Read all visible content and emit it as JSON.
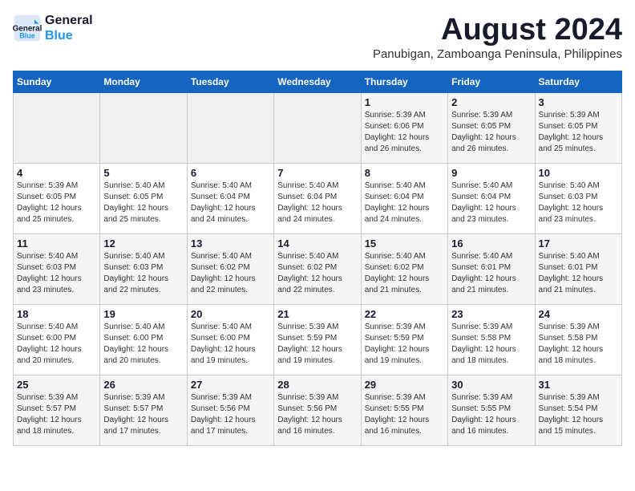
{
  "header": {
    "logo_line1": "General",
    "logo_line2": "Blue",
    "month_year": "August 2024",
    "subtitle": "Panubigan, Zamboanga Peninsula, Philippines"
  },
  "weekdays": [
    "Sunday",
    "Monday",
    "Tuesday",
    "Wednesday",
    "Thursday",
    "Friday",
    "Saturday"
  ],
  "weeks": [
    [
      {
        "day": "",
        "info": ""
      },
      {
        "day": "",
        "info": ""
      },
      {
        "day": "",
        "info": ""
      },
      {
        "day": "",
        "info": ""
      },
      {
        "day": "1",
        "info": "Sunrise: 5:39 AM\nSunset: 6:06 PM\nDaylight: 12 hours\nand 26 minutes."
      },
      {
        "day": "2",
        "info": "Sunrise: 5:39 AM\nSunset: 6:05 PM\nDaylight: 12 hours\nand 26 minutes."
      },
      {
        "day": "3",
        "info": "Sunrise: 5:39 AM\nSunset: 6:05 PM\nDaylight: 12 hours\nand 25 minutes."
      }
    ],
    [
      {
        "day": "4",
        "info": "Sunrise: 5:39 AM\nSunset: 6:05 PM\nDaylight: 12 hours\nand 25 minutes."
      },
      {
        "day": "5",
        "info": "Sunrise: 5:40 AM\nSunset: 6:05 PM\nDaylight: 12 hours\nand 25 minutes."
      },
      {
        "day": "6",
        "info": "Sunrise: 5:40 AM\nSunset: 6:04 PM\nDaylight: 12 hours\nand 24 minutes."
      },
      {
        "day": "7",
        "info": "Sunrise: 5:40 AM\nSunset: 6:04 PM\nDaylight: 12 hours\nand 24 minutes."
      },
      {
        "day": "8",
        "info": "Sunrise: 5:40 AM\nSunset: 6:04 PM\nDaylight: 12 hours\nand 24 minutes."
      },
      {
        "day": "9",
        "info": "Sunrise: 5:40 AM\nSunset: 6:04 PM\nDaylight: 12 hours\nand 23 minutes."
      },
      {
        "day": "10",
        "info": "Sunrise: 5:40 AM\nSunset: 6:03 PM\nDaylight: 12 hours\nand 23 minutes."
      }
    ],
    [
      {
        "day": "11",
        "info": "Sunrise: 5:40 AM\nSunset: 6:03 PM\nDaylight: 12 hours\nand 23 minutes."
      },
      {
        "day": "12",
        "info": "Sunrise: 5:40 AM\nSunset: 6:03 PM\nDaylight: 12 hours\nand 22 minutes."
      },
      {
        "day": "13",
        "info": "Sunrise: 5:40 AM\nSunset: 6:02 PM\nDaylight: 12 hours\nand 22 minutes."
      },
      {
        "day": "14",
        "info": "Sunrise: 5:40 AM\nSunset: 6:02 PM\nDaylight: 12 hours\nand 22 minutes."
      },
      {
        "day": "15",
        "info": "Sunrise: 5:40 AM\nSunset: 6:02 PM\nDaylight: 12 hours\nand 21 minutes."
      },
      {
        "day": "16",
        "info": "Sunrise: 5:40 AM\nSunset: 6:01 PM\nDaylight: 12 hours\nand 21 minutes."
      },
      {
        "day": "17",
        "info": "Sunrise: 5:40 AM\nSunset: 6:01 PM\nDaylight: 12 hours\nand 21 minutes."
      }
    ],
    [
      {
        "day": "18",
        "info": "Sunrise: 5:40 AM\nSunset: 6:00 PM\nDaylight: 12 hours\nand 20 minutes."
      },
      {
        "day": "19",
        "info": "Sunrise: 5:40 AM\nSunset: 6:00 PM\nDaylight: 12 hours\nand 20 minutes."
      },
      {
        "day": "20",
        "info": "Sunrise: 5:40 AM\nSunset: 6:00 PM\nDaylight: 12 hours\nand 19 minutes."
      },
      {
        "day": "21",
        "info": "Sunrise: 5:39 AM\nSunset: 5:59 PM\nDaylight: 12 hours\nand 19 minutes."
      },
      {
        "day": "22",
        "info": "Sunrise: 5:39 AM\nSunset: 5:59 PM\nDaylight: 12 hours\nand 19 minutes."
      },
      {
        "day": "23",
        "info": "Sunrise: 5:39 AM\nSunset: 5:58 PM\nDaylight: 12 hours\nand 18 minutes."
      },
      {
        "day": "24",
        "info": "Sunrise: 5:39 AM\nSunset: 5:58 PM\nDaylight: 12 hours\nand 18 minutes."
      }
    ],
    [
      {
        "day": "25",
        "info": "Sunrise: 5:39 AM\nSunset: 5:57 PM\nDaylight: 12 hours\nand 18 minutes."
      },
      {
        "day": "26",
        "info": "Sunrise: 5:39 AM\nSunset: 5:57 PM\nDaylight: 12 hours\nand 17 minutes."
      },
      {
        "day": "27",
        "info": "Sunrise: 5:39 AM\nSunset: 5:56 PM\nDaylight: 12 hours\nand 17 minutes."
      },
      {
        "day": "28",
        "info": "Sunrise: 5:39 AM\nSunset: 5:56 PM\nDaylight: 12 hours\nand 16 minutes."
      },
      {
        "day": "29",
        "info": "Sunrise: 5:39 AM\nSunset: 5:55 PM\nDaylight: 12 hours\nand 16 minutes."
      },
      {
        "day": "30",
        "info": "Sunrise: 5:39 AM\nSunset: 5:55 PM\nDaylight: 12 hours\nand 16 minutes."
      },
      {
        "day": "31",
        "info": "Sunrise: 5:39 AM\nSunset: 5:54 PM\nDaylight: 12 hours\nand 15 minutes."
      }
    ]
  ]
}
